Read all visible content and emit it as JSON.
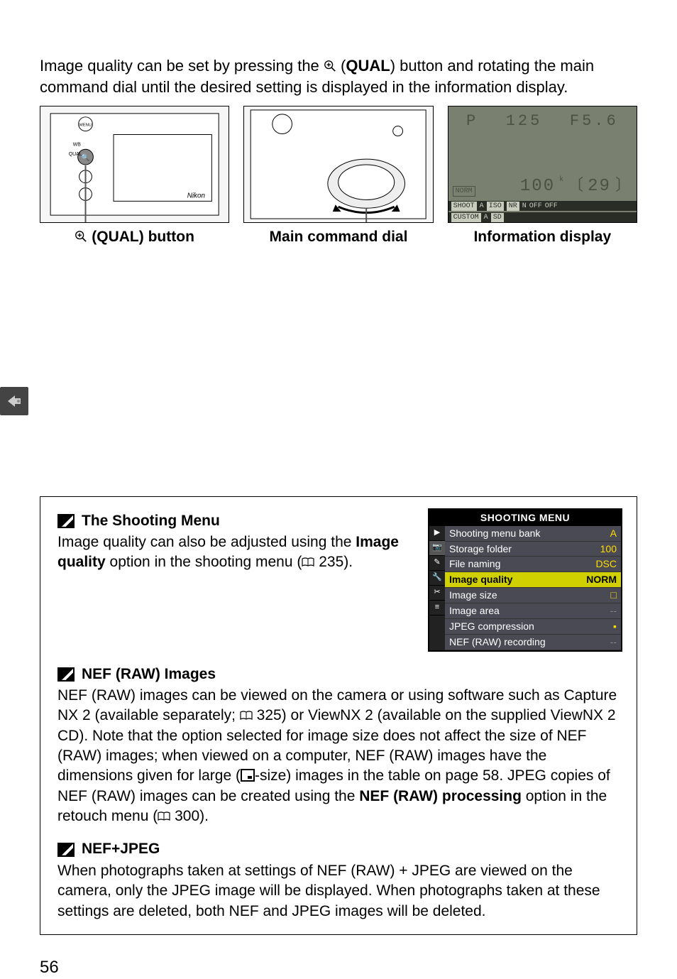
{
  "intro": {
    "t1": "Image quality can be set by pressing the ",
    "qual": "QUAL",
    "t2": ") button and rotating the main command dial until the desired setting is displayed in the information display."
  },
  "figcaps": {
    "a_prefix": " (",
    "a_qual": "QUAL",
    "a_suffix": ") button",
    "b": "Main command dial",
    "c": "Information display"
  },
  "lcd": {
    "topP": "P",
    "top125": "125",
    "topF56": "F5.6",
    "iso100": "100",
    "remain": "29",
    "norm": "NORM",
    "k": "k",
    "strip1": {
      "shoot": "SHOOT",
      "a": "A",
      "iso": "ISO",
      "nr": "NR",
      "n": "N",
      "hdr": "OFF",
      "off": "OFF"
    },
    "strip2": {
      "custom": "CUSTOM",
      "a": "A",
      "sd": "SD"
    }
  },
  "shootingMenu": {
    "title": "SHOOTING MENU",
    "items": [
      {
        "label": "Shooting menu bank",
        "val": "A"
      },
      {
        "label": "Storage folder",
        "val": "100"
      },
      {
        "label": "File naming",
        "val": "DSC"
      },
      {
        "label": "Image quality",
        "val": "NORM",
        "hl": true
      },
      {
        "label": "Image size",
        "val": "□"
      },
      {
        "label": "Image area",
        "val": "--",
        "gray": true
      },
      {
        "label": "JPEG compression",
        "val": "▪"
      },
      {
        "label": "NEF (RAW) recording",
        "val": "--",
        "gray": true
      }
    ]
  },
  "note1": {
    "head": "The Shooting Menu",
    "t1": "Image quality can also be adjusted using the ",
    "bold": "Image quality",
    "t2": " option in the shooting menu (",
    "ref": " 235).",
    "close": ""
  },
  "note2": {
    "head": "NEF (RAW) Images",
    "t1": "NEF (RAW) images can be viewed on the camera or using software such as Capture NX 2 (available separately; ",
    "ref1": " 325) or ViewNX 2 (available on the supplied ViewNX 2 CD).  Note that the option selected for image size does not affect the size of NEF (RAW) images; when viewed on a computer, NEF (RAW) images have the dimensions given for large (",
    "t2": "-size) images in the table on page 58.  JPEG copies of NEF (RAW) images can be created using the ",
    "bold": "NEF (RAW) processing",
    "t3": " option in the retouch menu (",
    "ref2": " 300)."
  },
  "note3": {
    "head": "NEF+JPEG",
    "body": "When photographs taken at settings of NEF (RAW) + JPEG are viewed on the camera, only the JPEG image will be displayed. When photographs taken at these settings are deleted, both NEF and JPEG images will be deleted."
  },
  "pageNumber": "56"
}
